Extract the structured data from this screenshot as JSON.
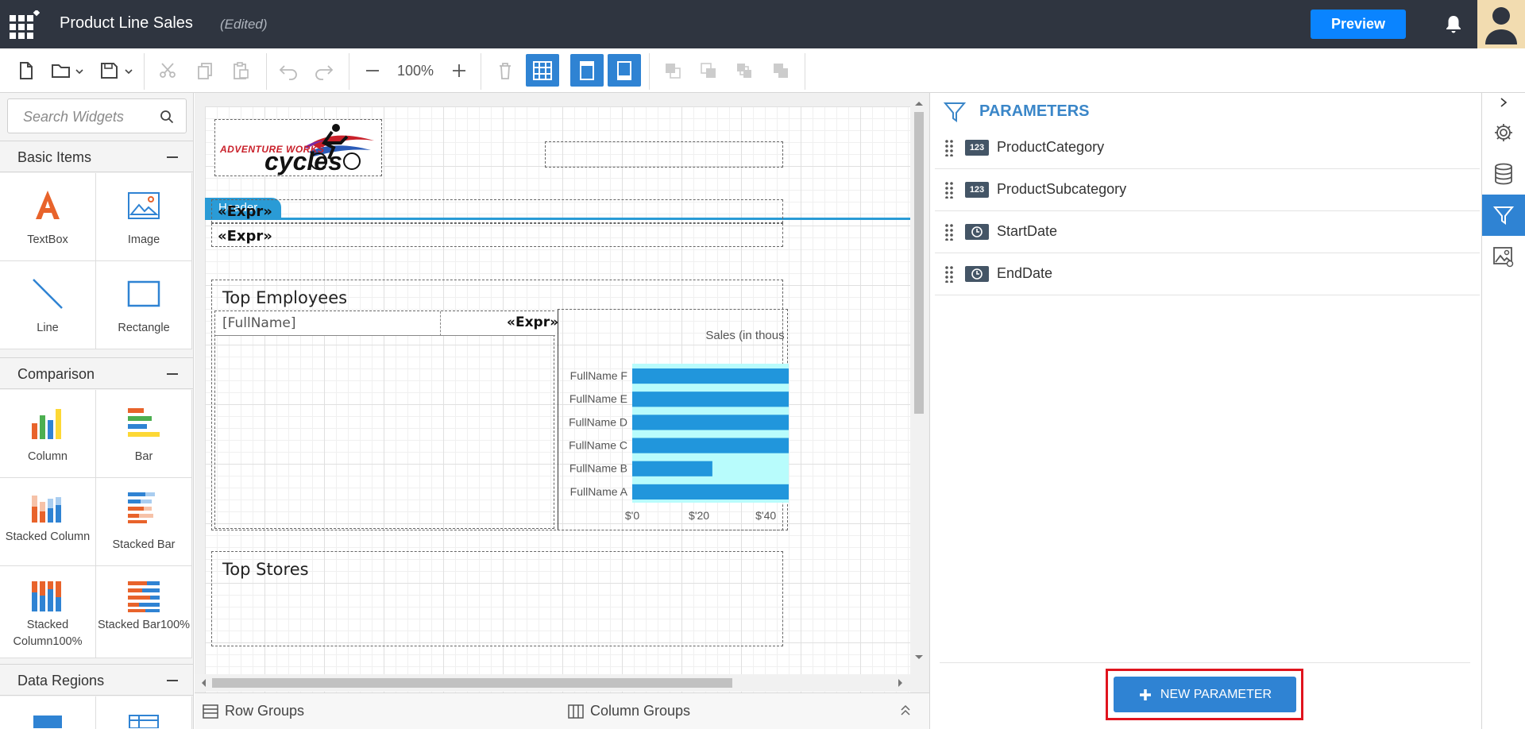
{
  "app": {
    "title": "Product Line Sales",
    "status": "(Edited)",
    "preview_label": "Preview"
  },
  "toolbar": {
    "zoom": "100%"
  },
  "widgets": {
    "search_placeholder": "Search Widgets",
    "sections": [
      {
        "title": "Basic Items",
        "items": [
          "TextBox",
          "Image",
          "Line",
          "Rectangle"
        ]
      },
      {
        "title": "Comparison",
        "items": [
          "Column",
          "Bar",
          "Stacked Column",
          "Stacked Bar",
          "Stacked Column100%",
          "Stacked Bar100%"
        ]
      },
      {
        "title": "Data Regions",
        "items": []
      }
    ]
  },
  "canvas": {
    "logo_text_top": "ADVENTURE WORKS",
    "logo_text_bottom": "cycles",
    "header_tab": "Header",
    "expr1": "«Expr»",
    "expr2": "«Expr»",
    "top_employees_title": "Top Employees",
    "fullname_cell": "[FullName]",
    "expr_cell": "«Expr»",
    "top_stores_title": "Top Stores",
    "chart_title": "Sales (in thous"
  },
  "chart_data": {
    "type": "bar",
    "title": "Sales (in thous",
    "categories": [
      "FullName F",
      "FullName E",
      "FullName D",
      "FullName C",
      "FullName B",
      "FullName A"
    ],
    "values": [
      60,
      60,
      60,
      60,
      24,
      48
    ],
    "xticks": [
      "$'0",
      "$'20",
      "$'40"
    ],
    "xlim": [
      0,
      60
    ],
    "color": "#2196dc",
    "plot_bg": "#b8fcfc",
    "grid": true
  },
  "groups": {
    "row_label": "Row Groups",
    "column_label": "Column Groups"
  },
  "parameters": {
    "title": "PARAMETERS",
    "items": [
      {
        "name": "ProductCategory",
        "type_icon": "number-icon",
        "type_badge": "123"
      },
      {
        "name": "ProductSubcategory",
        "type_icon": "number-icon",
        "type_badge": "123"
      },
      {
        "name": "StartDate",
        "type_icon": "clock-icon",
        "type_badge": ""
      },
      {
        "name": "EndDate",
        "type_icon": "clock-icon",
        "type_badge": ""
      }
    ],
    "new_button_label": "NEW PARAMETER"
  },
  "colors": {
    "topbar": "#2f3540",
    "accent": "#2f83d3",
    "preview": "#0a84ff",
    "highlight_outline": "#e0141e"
  }
}
